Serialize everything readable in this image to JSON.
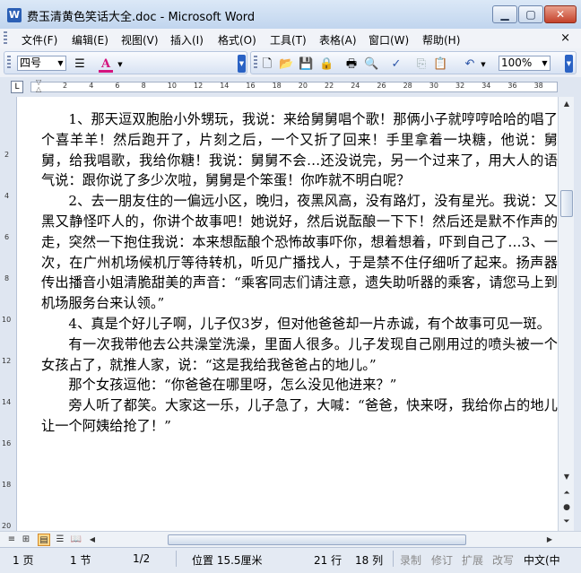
{
  "window": {
    "title": "费玉清黄色笑话大全.doc - Microsoft Word",
    "app_icon": "W"
  },
  "menu": {
    "items": [
      "文件(F)",
      "编辑(E)",
      "视图(V)",
      "插入(I)",
      "格式(O)",
      "工具(T)",
      "表格(A)",
      "窗口(W)",
      "帮助(H)"
    ],
    "close_doc": "×"
  },
  "toolbar": {
    "font_size": "四号",
    "zoom": "100%",
    "font_color": "#d4147e"
  },
  "ruler": {
    "h_numbers": [
      "2",
      "4",
      "6",
      "8",
      "10",
      "12",
      "14",
      "16",
      "18",
      "20",
      "22",
      "24",
      "26",
      "28",
      "30",
      "32",
      "34",
      "36",
      "38"
    ],
    "v_numbers": [
      "2",
      "4",
      "6",
      "8",
      "10",
      "12",
      "14",
      "16",
      "18",
      "20"
    ]
  },
  "document": {
    "paragraphs": [
      "1、那天逗双胞胎小外甥玩，我说：来给舅舅唱个歌！那俩小子就哼哼哈哈的唱了个喜羊羊！然后跑开了，片刻之后，一个又折了回来！手里拿着一块糖，他说：舅舅，给我唱歌，我给你糖！我说：舅舅不会…还没说完，另一个过来了，用大人的语气说：跟你说了多少次啦，舅舅是个笨蛋！你咋就不明白呢？",
      "2、去一朋友住的一偏远小区，晚归，夜黑风高，没有路灯，没有星光。我说：又黑又静怪吓人的，你讲个故事吧！她说好，然后说酝酿一下下！然后还是默不作声的走，突然一下抱住我说：本来想酝酿个恐怖故事吓你，想着想着，吓到自己了…3、一次，在广州机场候机厅等待转机，听见广播找人，于是禁不住仔细听了起来。扬声器传出播音小姐清脆甜美的声音：“乘客同志们请注意，遗失助听器的乘客，请您马上到机场服务台来认领。”",
      "4、真是个好儿子啊，儿子仅3岁，但对他爸爸却一片赤诚，有个故事可见一斑。",
      "有一次我带他去公共澡堂洗澡，里面人很多。儿子发现自己刚用过的喷头被一个女孩占了，就推人家，说：“这是我给我爸爸占的地儿。”",
      "那个女孩逗他：“你爸爸在哪里呀，怎么没见他进来？”",
      "旁人听了都笑。大家这一乐，儿子急了，大喊：“爸爸，快来呀，我给你占的地儿让一个阿姨给抢了！”"
    ]
  },
  "statusbar": {
    "page": "1 页",
    "section": "1 节",
    "page_of": "1/2",
    "position": "位置 15.5厘米",
    "line": "21 行",
    "column": "18 列",
    "rec": "录制",
    "trk": "修订",
    "ext": "扩展",
    "ovr": "改写",
    "language": "中文(中"
  }
}
